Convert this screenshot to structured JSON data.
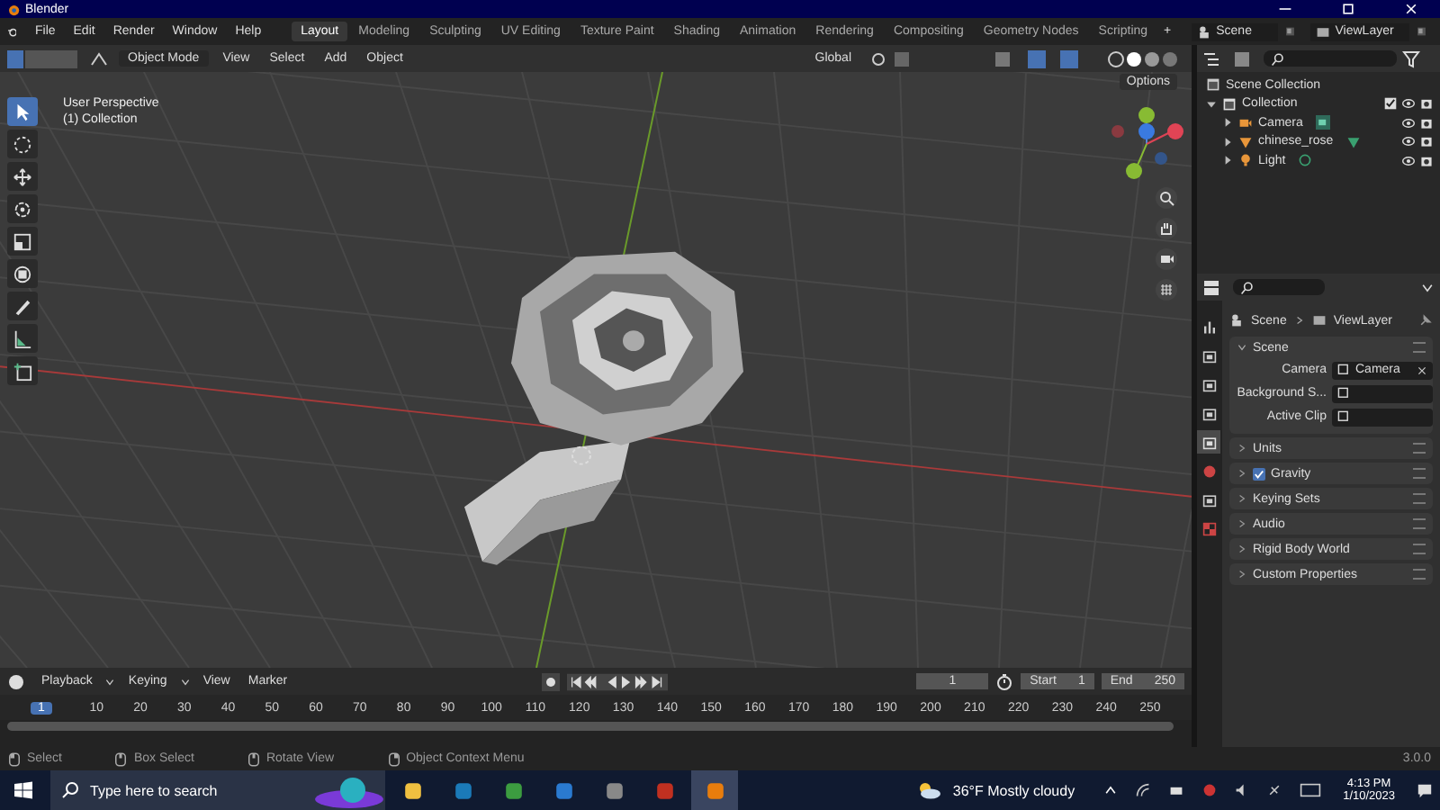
{
  "window": {
    "title": "Blender"
  },
  "menu": [
    "File",
    "Edit",
    "Render",
    "Window",
    "Help"
  ],
  "workspaces": [
    {
      "label": "Layout",
      "selected": true
    },
    {
      "label": "Modeling",
      "selected": false
    },
    {
      "label": "Sculpting",
      "selected": false
    },
    {
      "label": "UV Editing",
      "selected": false
    },
    {
      "label": "Texture Paint",
      "selected": false
    },
    {
      "label": "Shading",
      "selected": false
    },
    {
      "label": "Animation",
      "selected": false
    },
    {
      "label": "Rendering",
      "selected": false
    },
    {
      "label": "Compositing",
      "selected": false
    },
    {
      "label": "Geometry Nodes",
      "selected": false
    },
    {
      "label": "Scripting",
      "selected": false
    }
  ],
  "add_workspace": "+",
  "scene": "Scene",
  "view_layer": "ViewLayer",
  "viewport": {
    "mode": "Object Mode",
    "menus": [
      "View",
      "Select",
      "Add",
      "Object"
    ],
    "orientation": "Global",
    "options": "Options",
    "overlay_title": "User Perspective",
    "overlay_subtitle": "(1) Collection",
    "tools": [
      {
        "kind": "select",
        "selected": true
      },
      {
        "kind": "cursor",
        "selected": false
      },
      {
        "kind": "move",
        "selected": false
      },
      {
        "kind": "rotate",
        "selected": false
      },
      {
        "kind": "scale",
        "selected": false
      },
      {
        "kind": "transform",
        "selected": false
      },
      {
        "kind": "annotate",
        "selected": false
      },
      {
        "kind": "measure",
        "selected": false
      },
      {
        "kind": "add",
        "selected": false
      }
    ]
  },
  "outliner": {
    "items": [
      {
        "label": "Scene Collection",
        "children": [
          {
            "label": "Collection",
            "expanded": true,
            "checked": true,
            "children": [
              {
                "label": "Camera",
                "kind": "camera",
                "expanded": false
              },
              {
                "label": "chinese_rose",
                "kind": "mesh",
                "expanded": false
              },
              {
                "label": "Light",
                "kind": "light",
                "expanded": false
              }
            ]
          }
        ]
      }
    ]
  },
  "properties": {
    "breadcrumb": [
      "Scene",
      "ViewLayer"
    ],
    "tabs": [
      {
        "kind": "tool",
        "selected": false
      },
      {
        "kind": "render",
        "selected": false
      },
      {
        "kind": "output",
        "selected": false
      },
      {
        "kind": "view_layer",
        "selected": false
      },
      {
        "kind": "scene",
        "selected": true
      },
      {
        "kind": "world",
        "selected": false
      },
      {
        "kind": "collection",
        "selected": false
      },
      {
        "kind": "texture",
        "selected": false
      }
    ],
    "panel": {
      "title": "Scene",
      "expanded": true,
      "fields": [
        {
          "label": "Camera",
          "value": "Camera"
        },
        {
          "label": "Background S..."
        },
        {
          "label": "Active Clip"
        }
      ]
    },
    "subpanels": [
      {
        "label": "Units",
        "kind": "plain"
      },
      {
        "label": "Gravity",
        "kind": "toggle",
        "checked": true
      },
      {
        "label": "Keying Sets",
        "kind": "plain"
      },
      {
        "label": "Audio",
        "kind": "plain"
      },
      {
        "label": "Rigid Body World",
        "kind": "plain"
      },
      {
        "label": "Custom Properties",
        "kind": "plain"
      }
    ]
  },
  "timeline": {
    "menus": [
      "Playback",
      "Keying",
      "View",
      "Marker"
    ],
    "current_frame": "1",
    "start_label": "Start",
    "start": "1",
    "end_label": "End",
    "end": "250",
    "ticks": [
      {
        "label": "1",
        "selected": true
      },
      {
        "label": "10",
        "selected": false
      },
      {
        "label": "20",
        "selected": false
      },
      {
        "label": "30",
        "selected": false
      },
      {
        "label": "40",
        "selected": false
      },
      {
        "label": "50",
        "selected": false
      },
      {
        "label": "60",
        "selected": false
      },
      {
        "label": "70",
        "selected": false
      },
      {
        "label": "80",
        "selected": false
      },
      {
        "label": "90",
        "selected": false
      },
      {
        "label": "100",
        "selected": false
      },
      {
        "label": "110",
        "selected": false
      },
      {
        "label": "120",
        "selected": false
      },
      {
        "label": "130",
        "selected": false
      },
      {
        "label": "140",
        "selected": false
      },
      {
        "label": "150",
        "selected": false
      },
      {
        "label": "160",
        "selected": false
      },
      {
        "label": "170",
        "selected": false
      },
      {
        "label": "180",
        "selected": false
      },
      {
        "label": "190",
        "selected": false
      },
      {
        "label": "200",
        "selected": false
      },
      {
        "label": "210",
        "selected": false
      },
      {
        "label": "220",
        "selected": false
      },
      {
        "label": "230",
        "selected": false
      },
      {
        "label": "240",
        "selected": false
      },
      {
        "label": "250",
        "selected": false
      }
    ]
  },
  "status_bar": {
    "hints": [
      {
        "kind": "left",
        "label": "Select"
      },
      {
        "kind": "drag",
        "label": "Box Select"
      },
      {
        "kind": "middle",
        "label": "Rotate View"
      },
      {
        "kind": "right",
        "label": "Object Context Menu"
      }
    ],
    "version": "3.0.0"
  },
  "taskbar": {
    "search_placeholder": "Type here to search",
    "apps": [
      {
        "kind": "folder",
        "selected": false
      },
      {
        "kind": "steam",
        "selected": false
      },
      {
        "kind": "chrome",
        "selected": false
      },
      {
        "kind": "store",
        "selected": false
      },
      {
        "kind": "app",
        "selected": false
      },
      {
        "kind": "game",
        "selected": false
      },
      {
        "kind": "blender",
        "selected": true
      }
    ],
    "weather": "36°F Mostly cloudy",
    "time": "4:13 PM",
    "date": "1/10/2023"
  }
}
